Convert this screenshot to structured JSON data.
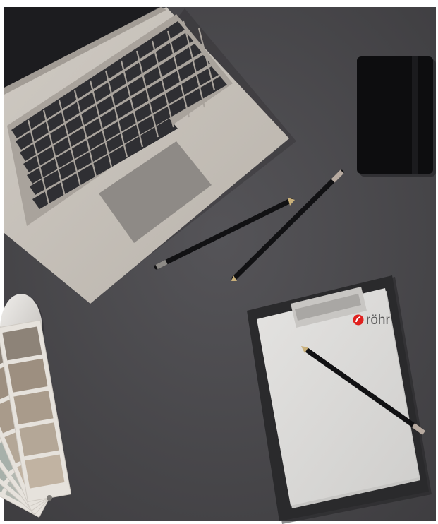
{
  "brand": {
    "name": "röhr",
    "mark_color": "#e0201e",
    "text_color": "#5a5a5a"
  },
  "scene": {
    "desk_color": "#4b4a4d",
    "laptop_color": "#c6c0b8",
    "key_color": "#2f2f33",
    "trackpad_color": "#8e8a86",
    "notebook_color": "#0d0d0f",
    "clipboard_color": "#2a2a2c",
    "paper_color": "#d9d8d6",
    "pencil_color": "#111113",
    "mouse_color": "#dedcd9"
  },
  "swatches": [
    "#7e8c8a",
    "#8f9a94",
    "#9aa5a0",
    "#a7b0aa",
    "#b3b8b1",
    "#8d8378",
    "#9d8f80",
    "#a99b8b",
    "#b4a797",
    "#c1b3a2"
  ]
}
